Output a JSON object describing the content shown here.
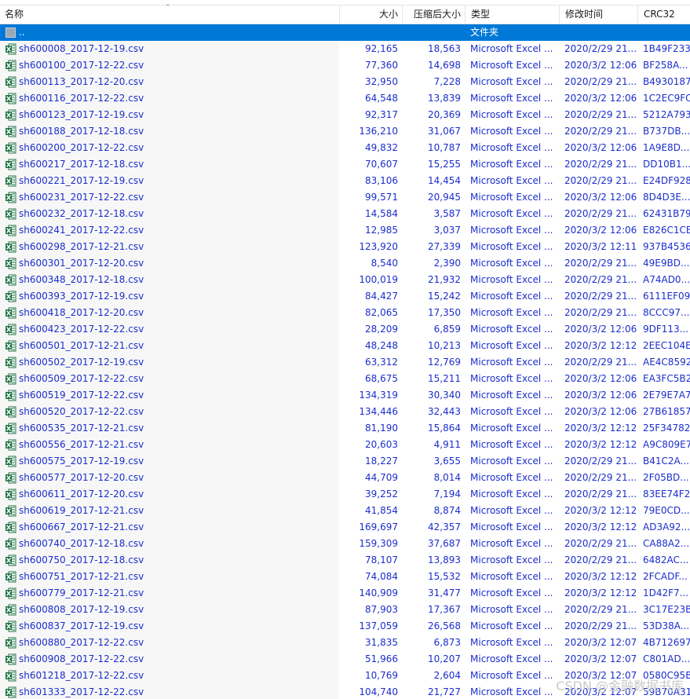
{
  "columns": {
    "name": "名称",
    "size": "大小",
    "compressed": "压缩后大小",
    "type": "类型",
    "modified": "修改时间",
    "crc": "CRC32"
  },
  "parent_row": {
    "name": "..",
    "type": "文件夹"
  },
  "file_icon": "excel-file-icon",
  "folder_icon": "folder-up-icon",
  "colors": {
    "link_text": "#1b2ecc",
    "selection": "#0078d7",
    "excel_green": "#1f7244"
  },
  "files": [
    {
      "name": "sh600008_2017-12-19.csv",
      "size": "92,165",
      "comp": "18,563",
      "type": "Microsoft Excel ...",
      "mod": "2020/2/29 21...",
      "crc": "1B49F233"
    },
    {
      "name": "sh600100_2017-12-22.csv",
      "size": "77,360",
      "comp": "14,698",
      "type": "Microsoft Excel ...",
      "mod": "2020/3/2 12:06",
      "crc": "BF258A..."
    },
    {
      "name": "sh600113_2017-12-20.csv",
      "size": "32,950",
      "comp": "7,228",
      "type": "Microsoft Excel ...",
      "mod": "2020/2/29 21...",
      "crc": "B4930187"
    },
    {
      "name": "sh600116_2017-12-22.csv",
      "size": "64,548",
      "comp": "13,839",
      "type": "Microsoft Excel ...",
      "mod": "2020/3/2 12:06",
      "crc": "1C2EC9FC"
    },
    {
      "name": "sh600123_2017-12-19.csv",
      "size": "92,317",
      "comp": "20,369",
      "type": "Microsoft Excel ...",
      "mod": "2020/2/29 21...",
      "crc": "5212A793"
    },
    {
      "name": "sh600188_2017-12-18.csv",
      "size": "136,210",
      "comp": "31,067",
      "type": "Microsoft Excel ...",
      "mod": "2020/2/29 21...",
      "crc": "B737DB..."
    },
    {
      "name": "sh600200_2017-12-22.csv",
      "size": "49,832",
      "comp": "10,787",
      "type": "Microsoft Excel ...",
      "mod": "2020/3/2 12:06",
      "crc": "1A9E8D..."
    },
    {
      "name": "sh600217_2017-12-18.csv",
      "size": "70,607",
      "comp": "15,255",
      "type": "Microsoft Excel ...",
      "mod": "2020/2/29 21...",
      "crc": "DD10B1..."
    },
    {
      "name": "sh600221_2017-12-19.csv",
      "size": "83,106",
      "comp": "14,454",
      "type": "Microsoft Excel ...",
      "mod": "2020/2/29 21...",
      "crc": "E24DF928"
    },
    {
      "name": "sh600231_2017-12-22.csv",
      "size": "99,571",
      "comp": "20,945",
      "type": "Microsoft Excel ...",
      "mod": "2020/3/2 12:06",
      "crc": "8D4D3E..."
    },
    {
      "name": "sh600232_2017-12-18.csv",
      "size": "14,584",
      "comp": "3,587",
      "type": "Microsoft Excel ...",
      "mod": "2020/2/29 21...",
      "crc": "62431B79"
    },
    {
      "name": "sh600241_2017-12-22.csv",
      "size": "12,985",
      "comp": "3,037",
      "type": "Microsoft Excel ...",
      "mod": "2020/3/2 12:06",
      "crc": "E826C1CE"
    },
    {
      "name": "sh600298_2017-12-21.csv",
      "size": "123,920",
      "comp": "27,339",
      "type": "Microsoft Excel ...",
      "mod": "2020/3/2 12:11",
      "crc": "937B4536"
    },
    {
      "name": "sh600301_2017-12-20.csv",
      "size": "8,540",
      "comp": "2,390",
      "type": "Microsoft Excel ...",
      "mod": "2020/2/29 21...",
      "crc": "49E9BD..."
    },
    {
      "name": "sh600348_2017-12-18.csv",
      "size": "100,019",
      "comp": "21,932",
      "type": "Microsoft Excel ...",
      "mod": "2020/2/29 21...",
      "crc": "A74AD0..."
    },
    {
      "name": "sh600393_2017-12-19.csv",
      "size": "84,427",
      "comp": "15,242",
      "type": "Microsoft Excel ...",
      "mod": "2020/2/29 21...",
      "crc": "6111EF09"
    },
    {
      "name": "sh600418_2017-12-20.csv",
      "size": "82,065",
      "comp": "17,350",
      "type": "Microsoft Excel ...",
      "mod": "2020/2/29 21...",
      "crc": "8CCC97..."
    },
    {
      "name": "sh600423_2017-12-22.csv",
      "size": "28,209",
      "comp": "6,859",
      "type": "Microsoft Excel ...",
      "mod": "2020/3/2 12:06",
      "crc": "9DF113..."
    },
    {
      "name": "sh600501_2017-12-21.csv",
      "size": "48,248",
      "comp": "10,213",
      "type": "Microsoft Excel ...",
      "mod": "2020/3/2 12:12",
      "crc": "2EEC104E"
    },
    {
      "name": "sh600502_2017-12-19.csv",
      "size": "63,312",
      "comp": "12,769",
      "type": "Microsoft Excel ...",
      "mod": "2020/2/29 21...",
      "crc": "AE4C8592"
    },
    {
      "name": "sh600509_2017-12-22.csv",
      "size": "68,675",
      "comp": "15,211",
      "type": "Microsoft Excel ...",
      "mod": "2020/3/2 12:06",
      "crc": "EA3FC5B2"
    },
    {
      "name": "sh600519_2017-12-22.csv",
      "size": "134,319",
      "comp": "30,340",
      "type": "Microsoft Excel ...",
      "mod": "2020/3/2 12:06",
      "crc": "2E79E7A7"
    },
    {
      "name": "sh600520_2017-12-22.csv",
      "size": "134,446",
      "comp": "32,443",
      "type": "Microsoft Excel ...",
      "mod": "2020/3/2 12:06",
      "crc": "27B61857"
    },
    {
      "name": "sh600535_2017-12-21.csv",
      "size": "81,190",
      "comp": "15,864",
      "type": "Microsoft Excel ...",
      "mod": "2020/3/2 12:12",
      "crc": "25F34782"
    },
    {
      "name": "sh600556_2017-12-21.csv",
      "size": "20,603",
      "comp": "4,911",
      "type": "Microsoft Excel ...",
      "mod": "2020/3/2 12:12",
      "crc": "A9C809E7"
    },
    {
      "name": "sh600575_2017-12-19.csv",
      "size": "18,227",
      "comp": "3,655",
      "type": "Microsoft Excel ...",
      "mod": "2020/2/29 21...",
      "crc": "B41C2A..."
    },
    {
      "name": "sh600577_2017-12-20.csv",
      "size": "44,709",
      "comp": "8,014",
      "type": "Microsoft Excel ...",
      "mod": "2020/2/29 21...",
      "crc": "2F05BD..."
    },
    {
      "name": "sh600611_2017-12-20.csv",
      "size": "39,252",
      "comp": "7,194",
      "type": "Microsoft Excel ...",
      "mod": "2020/2/29 21...",
      "crc": "83EE74F2"
    },
    {
      "name": "sh600619_2017-12-21.csv",
      "size": "41,854",
      "comp": "8,874",
      "type": "Microsoft Excel ...",
      "mod": "2020/3/2 12:12",
      "crc": "79E0CD..."
    },
    {
      "name": "sh600667_2017-12-21.csv",
      "size": "169,697",
      "comp": "42,357",
      "type": "Microsoft Excel ...",
      "mod": "2020/3/2 12:12",
      "crc": "AD3A92..."
    },
    {
      "name": "sh600740_2017-12-18.csv",
      "size": "159,309",
      "comp": "37,687",
      "type": "Microsoft Excel ...",
      "mod": "2020/2/29 21...",
      "crc": "CA88A2..."
    },
    {
      "name": "sh600750_2017-12-18.csv",
      "size": "78,107",
      "comp": "13,893",
      "type": "Microsoft Excel ...",
      "mod": "2020/2/29 21...",
      "crc": "6482AC..."
    },
    {
      "name": "sh600751_2017-12-21.csv",
      "size": "74,084",
      "comp": "15,532",
      "type": "Microsoft Excel ...",
      "mod": "2020/3/2 12:12",
      "crc": "2FCADF..."
    },
    {
      "name": "sh600779_2017-12-21.csv",
      "size": "140,909",
      "comp": "31,477",
      "type": "Microsoft Excel ...",
      "mod": "2020/3/2 12:12",
      "crc": "1D42F7..."
    },
    {
      "name": "sh600808_2017-12-19.csv",
      "size": "87,903",
      "comp": "17,367",
      "type": "Microsoft Excel ...",
      "mod": "2020/2/29 21...",
      "crc": "3C17E23B"
    },
    {
      "name": "sh600837_2017-12-19.csv",
      "size": "137,059",
      "comp": "26,568",
      "type": "Microsoft Excel ...",
      "mod": "2020/2/29 21...",
      "crc": "53D38A..."
    },
    {
      "name": "sh600880_2017-12-22.csv",
      "size": "31,835",
      "comp": "6,873",
      "type": "Microsoft Excel ...",
      "mod": "2020/3/2 12:07",
      "crc": "4B712697"
    },
    {
      "name": "sh600908_2017-12-22.csv",
      "size": "51,966",
      "comp": "10,207",
      "type": "Microsoft Excel ...",
      "mod": "2020/3/2 12:07",
      "crc": "C801AD..."
    },
    {
      "name": "sh601218_2017-12-22.csv",
      "size": "10,769",
      "comp": "2,604",
      "type": "Microsoft Excel ...",
      "mod": "2020/3/2 12:07",
      "crc": "0580C95B"
    },
    {
      "name": "sh601333_2017-12-22.csv",
      "size": "104,740",
      "comp": "21,727",
      "type": "Microsoft Excel ...",
      "mod": "2020/3/2 12:07",
      "crc": "59B70A31"
    }
  ],
  "watermark": "CSDN @金融数据书库"
}
